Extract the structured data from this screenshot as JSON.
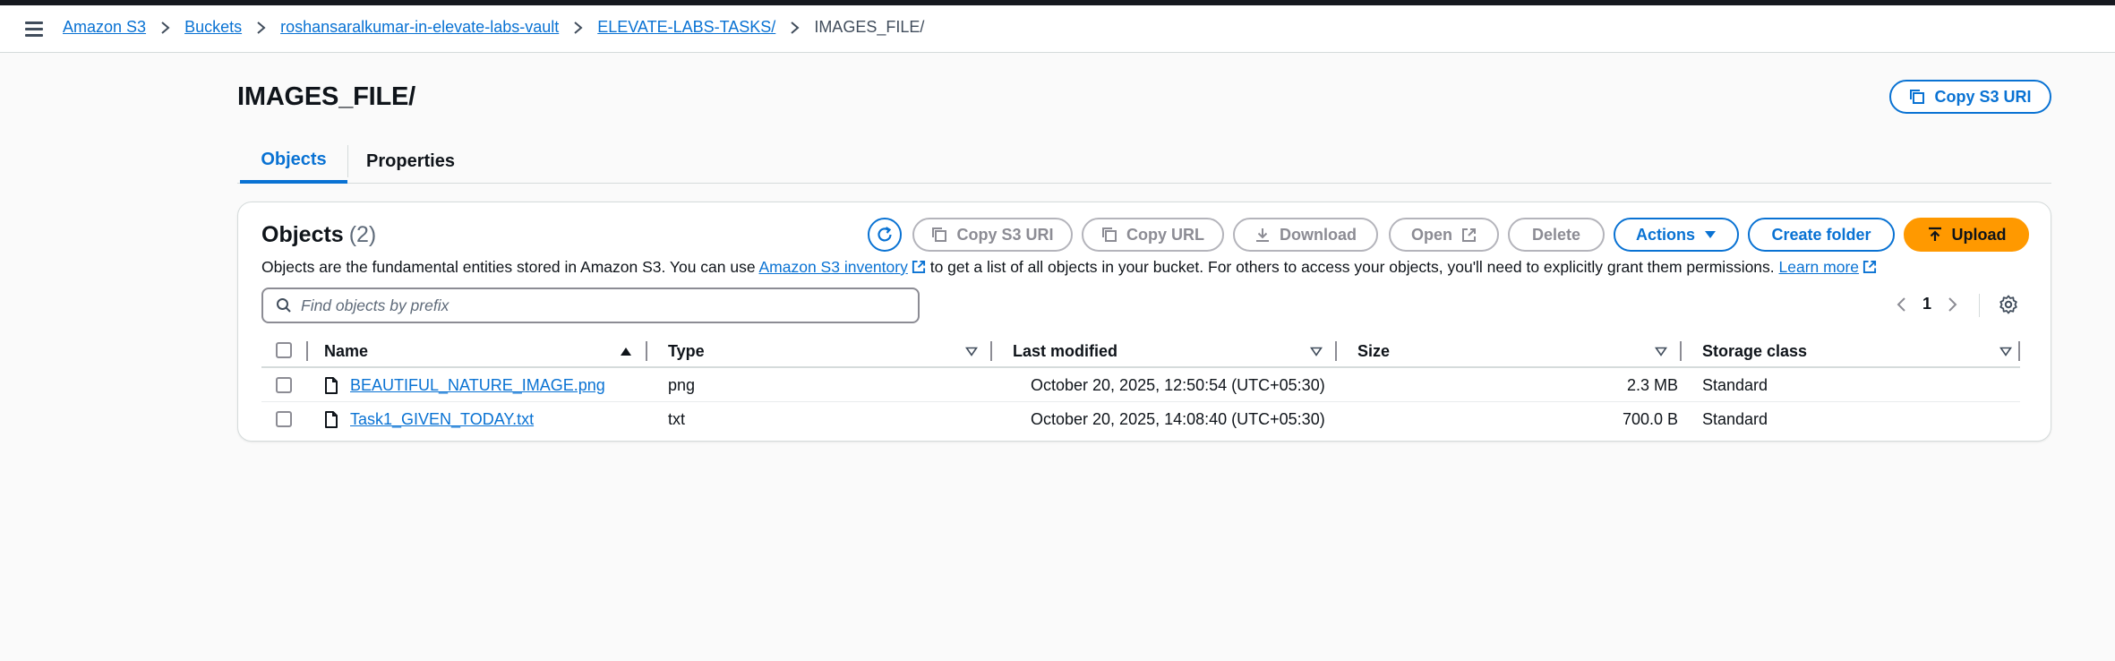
{
  "breadcrumb": {
    "items": [
      "Amazon S3",
      "Buckets",
      "roshansaralkumar-in-elevate-labs-vault",
      "ELEVATE-LABS-TASKS/"
    ],
    "current": "IMAGES_FILE/"
  },
  "page": {
    "title": "IMAGES_FILE/",
    "copy_uri_label": "Copy S3 URI"
  },
  "tabs": [
    {
      "label": "Objects",
      "active": true
    },
    {
      "label": "Properties",
      "active": false
    }
  ],
  "objects_panel": {
    "heading": "Objects",
    "count": "(2)",
    "description_prefix": "Objects are the fundamental entities stored in Amazon S3. You can use ",
    "inventory_link": "Amazon S3 inventory",
    "description_middle": " to get a list of all objects in your bucket. For others to access your objects, you'll need to explicitly grant them permissions. ",
    "learn_more": "Learn more",
    "toolbar": {
      "copy_s3_uri": "Copy S3 URI",
      "copy_url": "Copy URL",
      "download": "Download",
      "open": "Open",
      "delete": "Delete",
      "actions": "Actions",
      "create_folder": "Create folder",
      "upload": "Upload"
    },
    "search_placeholder": "Find objects by prefix",
    "page_number": "1"
  },
  "table": {
    "columns": [
      "Name",
      "Type",
      "Last modified",
      "Size",
      "Storage class"
    ],
    "rows": [
      {
        "name": "BEAUTIFUL_NATURE_IMAGE.png",
        "type": "png",
        "last_modified": "October 20, 2025, 12:50:54 (UTC+05:30)",
        "size": "2.3 MB",
        "storage_class": "Standard"
      },
      {
        "name": "Task1_GIVEN_TODAY.txt",
        "type": "txt",
        "last_modified": "October 20, 2025, 14:08:40 (UTC+05:30)",
        "size": "700.0 B",
        "storage_class": "Standard"
      }
    ]
  },
  "colors": {
    "link": "#0972d3",
    "primary_button": "#ff9900",
    "topbar": "#16191f"
  },
  "icons": [
    "menu-icon",
    "chevron-right-icon",
    "copy-icon",
    "refresh-icon",
    "download-icon",
    "external-link-icon",
    "caret-down-icon",
    "upload-icon",
    "search-icon",
    "chevron-left-icon",
    "settings-gear-icon",
    "sort-ascending-icon",
    "sort-icon",
    "file-icon"
  ]
}
